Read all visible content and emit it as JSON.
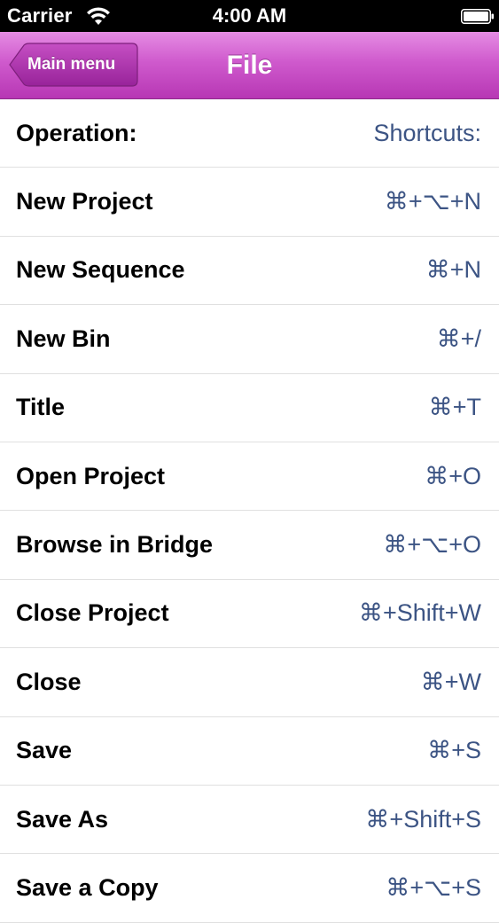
{
  "status_bar": {
    "carrier": "Carrier",
    "time": "4:00 AM",
    "wifi_icon": "wifi-icon",
    "battery_icon": "battery-icon"
  },
  "nav_bar": {
    "back_label": "Main menu",
    "title": "File",
    "accent_color": "#cf5acd"
  },
  "list": {
    "header": {
      "operation": "Operation:",
      "shortcut": "Shortcuts:"
    },
    "items": [
      {
        "operation": "New Project",
        "shortcut": "⌘+⌥+N"
      },
      {
        "operation": "New Sequence",
        "shortcut": "⌘+N"
      },
      {
        "operation": "New Bin",
        "shortcut": "⌘+/"
      },
      {
        "operation": "Title",
        "shortcut": "⌘+T"
      },
      {
        "operation": "Open Project",
        "shortcut": "⌘+O"
      },
      {
        "operation": "Browse in Bridge",
        "shortcut": "⌘+⌥+O"
      },
      {
        "operation": "Close Project",
        "shortcut": "⌘+Shift+W"
      },
      {
        "operation": "Close",
        "shortcut": "⌘+W"
      },
      {
        "operation": "Save",
        "shortcut": "⌘+S"
      },
      {
        "operation": "Save As",
        "shortcut": "⌘+Shift+S"
      },
      {
        "operation": "Save a Copy",
        "shortcut": "⌘+⌥+S"
      }
    ],
    "shortcut_color": "#3c5484"
  }
}
